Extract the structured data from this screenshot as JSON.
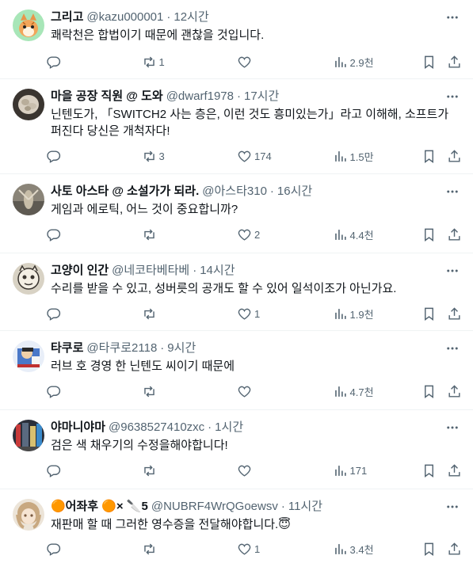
{
  "posts": [
    {
      "name": "그리고",
      "handle": "@kazu000001",
      "time": "12시간",
      "text": "쾌락천은 합법이기 때문에 괜찮을 것입니다.",
      "replies": "",
      "reposts": "1",
      "likes": "",
      "views": "2.9천"
    },
    {
      "name": "마을 공장 직원 @ 도와",
      "handle": "@dwarf1978",
      "time": "17시간",
      "text": "닌텐도가, 「SWITCH2 사는 층은, 이런 것도 흥미있는가」라고 이해해, 소프트가 퍼진다 당신은 개척자다!",
      "replies": "",
      "reposts": "3",
      "likes": "174",
      "views": "1.5만"
    },
    {
      "name": "사토 아스타 @ 소설가가 되라.",
      "handle": "@아스타310",
      "time": "16시간",
      "text": "게임과 에로틱, 어느 것이 중요합니까?",
      "replies": "",
      "reposts": "",
      "likes": "2",
      "views": "4.4천"
    },
    {
      "name": "고양이 인간",
      "handle": "@네코타베타베",
      "time": "14시간",
      "text": "수리를 받을 수 있고, 성버릇의 공개도 할 수 있어 일석이조가 아닌가요.",
      "replies": "",
      "reposts": "",
      "likes": "1",
      "views": "1.9천"
    },
    {
      "name": "타쿠로",
      "handle": "@타쿠로2118",
      "time": "9시간",
      "text": "러브 호 경영 한 닌텐도 씨이기 때문에",
      "replies": "",
      "reposts": "",
      "likes": "",
      "views": "4.7천"
    },
    {
      "name": "야마니야마",
      "handle": "@9638527410zxc",
      "time": "1시간",
      "text": "검은 색 채우기의 수정을해야합니다!",
      "replies": "",
      "reposts": "",
      "likes": "",
      "views": "171"
    },
    {
      "name": "🟠어좌후 🟠× 🔪5",
      "handle": "@NUBRF4WrQGoewsv",
      "time": "11시간",
      "text": "재판매 할 때 그러한 영수증을 전달해야합니다.😇",
      "replies": "",
      "reposts": "",
      "likes": "1",
      "views": "3.4천"
    }
  ],
  "icons": {
    "more": "more-horizontal-icon",
    "reply": "reply-icon",
    "repost": "repost-icon",
    "like": "heart-icon",
    "views": "views-chart-icon",
    "bookmark": "bookmark-icon",
    "share": "share-icon"
  },
  "colors": {
    "text": "#0f1419",
    "secondary": "#536471",
    "divider": "#eff3f4"
  }
}
